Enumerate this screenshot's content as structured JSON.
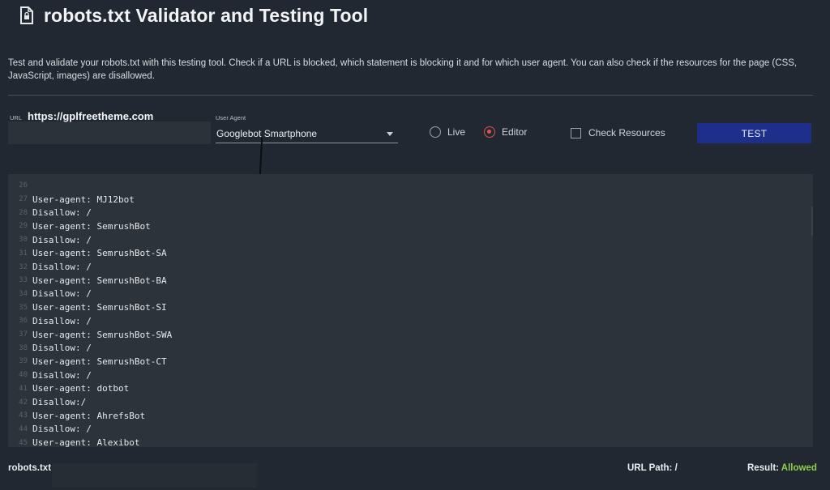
{
  "header": {
    "title": "robots.txt Validator and Testing Tool",
    "icon": "document-icon"
  },
  "description": "Test and validate your robots.txt with this testing tool. Check if a URL is blocked, which statement is blocking it and for which user agent. You can also check if the resources for the page (CSS, JavaScript, images) are disallowed.",
  "controls": {
    "url_label": "URL",
    "url_value": "https://gplfreetheme.com",
    "user_agent_label": "User Agent",
    "user_agent_value": "Googlebot Smartphone",
    "radio_live": "Live",
    "radio_editor": "Editor",
    "selected_mode": "Editor",
    "check_resources_label": "Check Resources",
    "check_resources_checked": false,
    "test_button": "TEST"
  },
  "editor": {
    "lines": [
      {
        "n": "26",
        "text": ""
      },
      {
        "n": "27",
        "text": "User-agent: MJ12bot"
      },
      {
        "n": "28",
        "text": "Disallow: /"
      },
      {
        "n": "29",
        "text": "User-agent: SemrushBot"
      },
      {
        "n": "30",
        "text": "Disallow: /"
      },
      {
        "n": "31",
        "text": "User-agent: SemrushBot-SA"
      },
      {
        "n": "32",
        "text": "Disallow: /"
      },
      {
        "n": "33",
        "text": "User-agent: SemrushBot-BA"
      },
      {
        "n": "34",
        "text": "Disallow: /"
      },
      {
        "n": "35",
        "text": "User-agent: SemrushBot-SI"
      },
      {
        "n": "36",
        "text": "Disallow: /"
      },
      {
        "n": "37",
        "text": "User-agent: SemrushBot-SWA"
      },
      {
        "n": "38",
        "text": "Disallow: /"
      },
      {
        "n": "39",
        "text": "User-agent: SemrushBot-CT"
      },
      {
        "n": "40",
        "text": "Disallow: /"
      },
      {
        "n": "41",
        "text": "User-agent: dotbot"
      },
      {
        "n": "42",
        "text": "Disallow:/"
      },
      {
        "n": "43",
        "text": "User-agent: AhrefsBot"
      },
      {
        "n": "44",
        "text": "Disallow: /"
      },
      {
        "n": "45",
        "text": "User-agent: Alexibot"
      }
    ]
  },
  "footer": {
    "robots_label": "robots.txt:",
    "url_path_label": "URL Path: /",
    "result_label": "Result:",
    "result_value": "Allowed",
    "result_color": "#8ccf4d"
  }
}
